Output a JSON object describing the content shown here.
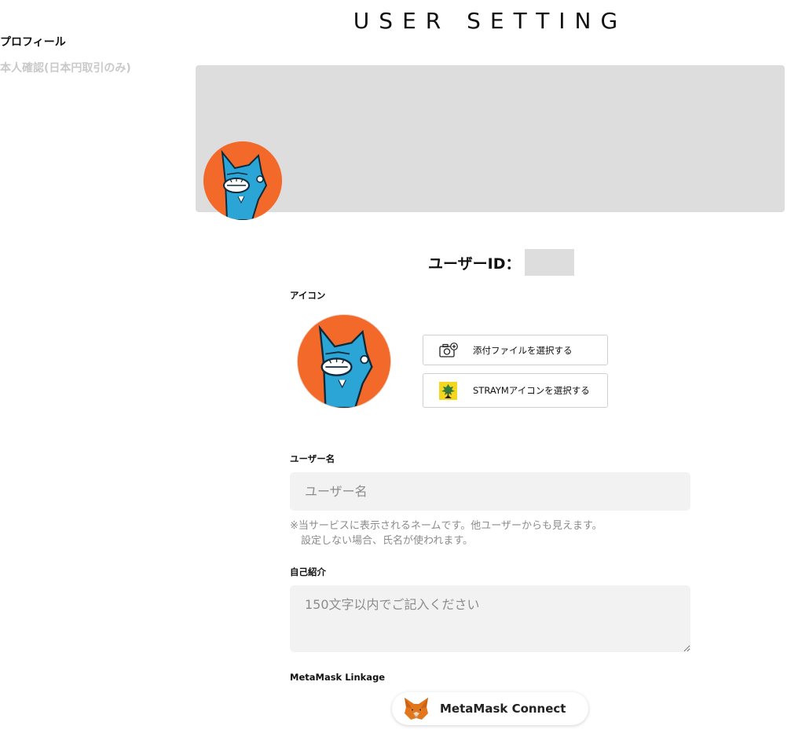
{
  "page": {
    "title": "USER SETTING"
  },
  "sidebar": {
    "items": [
      {
        "label": "プロフィール",
        "active": true
      },
      {
        "label": "本人確認(日本円取引のみ)",
        "active": false
      }
    ]
  },
  "profile": {
    "user_id_label": "ユーザーID："
  },
  "icon_section": {
    "label": "アイコン",
    "attach_button": "添付ファイルを選択する",
    "straym_button": "STRAYMアイコンを選択する"
  },
  "username": {
    "label": "ユーザー名",
    "placeholder": "ユーザー名",
    "value": "",
    "note_line1": "※当サービスに表示されるネームです。他ユーザーからも見えます。",
    "note_line2": "設定しない場合、氏名が使われます。"
  },
  "bio": {
    "label": "自己紹介",
    "placeholder": "150文字以内でご記入ください",
    "value": ""
  },
  "metamask": {
    "label": "MetaMask Linkage",
    "button": "MetaMask Connect"
  },
  "colors": {
    "avatar_background": "#f3692a",
    "cover": "#dddddd",
    "input_background": "#f2f2f2",
    "inactive_text": "#c9c9c9"
  },
  "icons": {
    "attach": "camera-plus-icon",
    "straym": "straym-tree-icon",
    "metamask": "metamask-fox-icon"
  }
}
